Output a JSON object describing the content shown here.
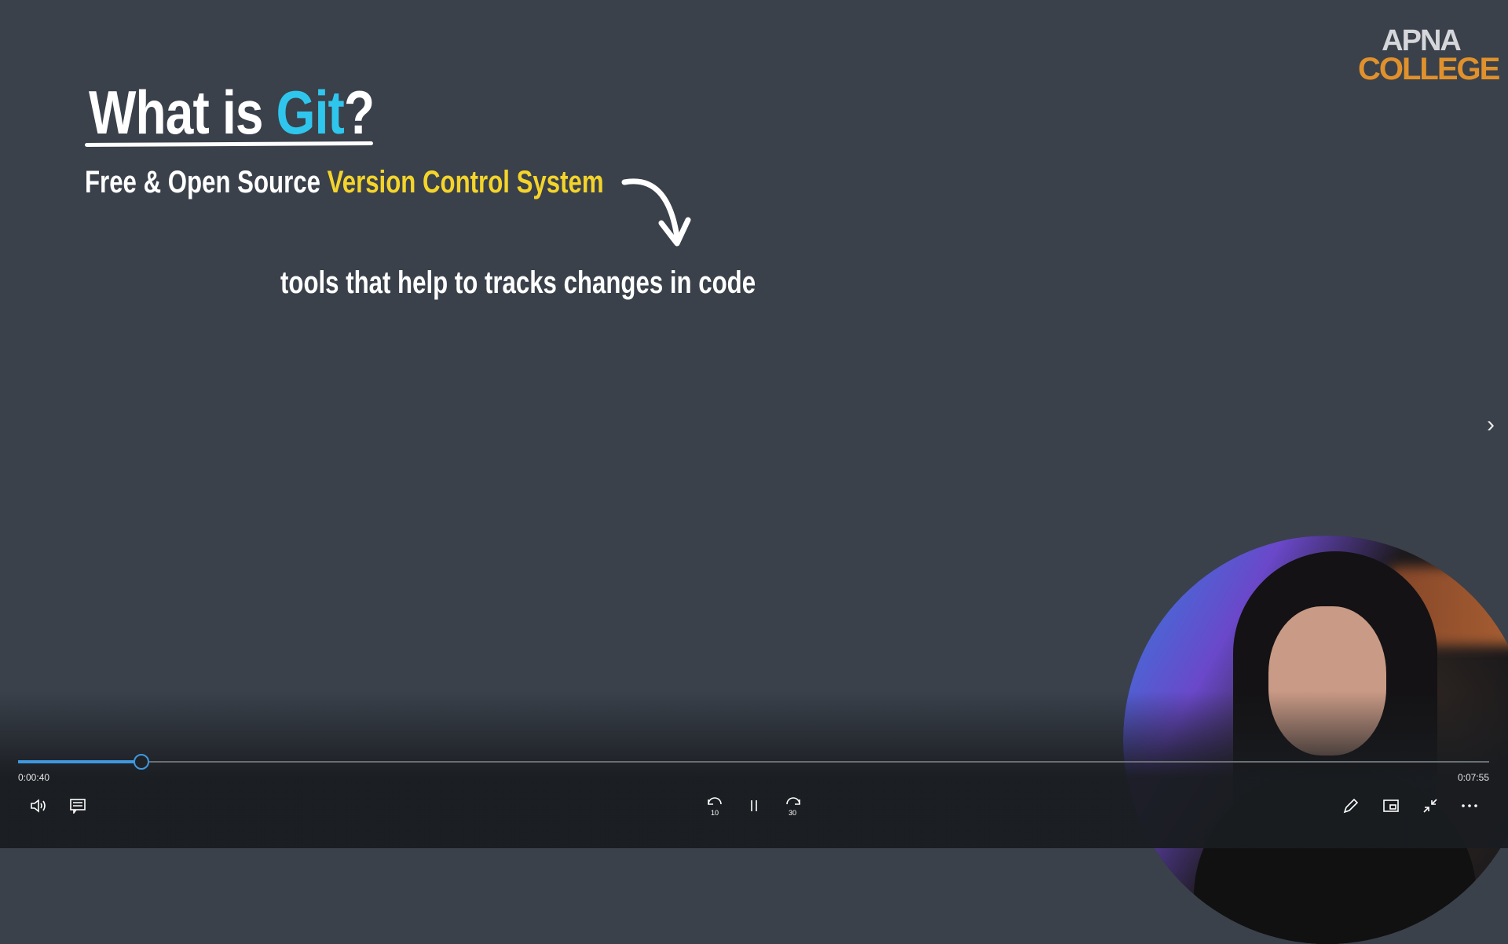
{
  "slide": {
    "title_prefix": "What is ",
    "title_highlight": "Git",
    "title_suffix": "?",
    "subtitle_prefix": "Free & Open Source ",
    "subtitle_highlight": "Version Control System",
    "description": "tools that help to tracks changes in code"
  },
  "logo": {
    "line1": "APNA",
    "line2": "COLLEGE"
  },
  "player": {
    "current_time": "0:00:40",
    "total_time": "0:07:55",
    "progress_fraction": 0.084,
    "skip_back_seconds": "10",
    "skip_forward_seconds": "30"
  },
  "colors": {
    "accent": "#3f98e0",
    "git": "#2fc6ee",
    "highlight": "#f5d42a",
    "logo_orange": "#e1912c",
    "background": "#3a414b"
  }
}
